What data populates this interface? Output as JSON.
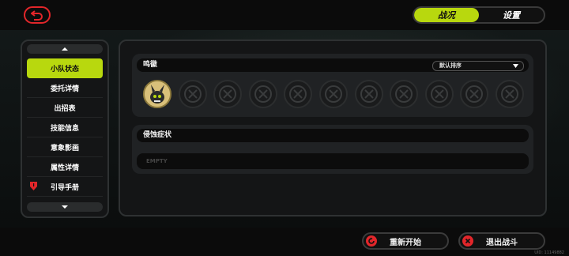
{
  "header": {
    "tabs": [
      {
        "label": "战况",
        "active": true
      },
      {
        "label": "设置",
        "active": false
      }
    ]
  },
  "sidebar": {
    "items": [
      {
        "label": "小队状态",
        "active": true
      },
      {
        "label": "委托详情",
        "active": false
      },
      {
        "label": "出招表",
        "active": false
      },
      {
        "label": "技能信息",
        "active": false
      },
      {
        "label": "意象影画",
        "active": false
      },
      {
        "label": "属性详情",
        "active": false
      },
      {
        "label": "引导手册",
        "active": false,
        "alert": true
      }
    ]
  },
  "main": {
    "badges_title": "鸣徽",
    "sort_select": "默认排序",
    "slots": [
      {
        "filled": true,
        "icon": "bangboo-badge-icon"
      },
      {
        "filled": false,
        "icon": "empty-slot-icon"
      },
      {
        "filled": false,
        "icon": "empty-slot-icon"
      },
      {
        "filled": false,
        "icon": "empty-slot-icon"
      },
      {
        "filled": false,
        "icon": "empty-slot-icon"
      },
      {
        "filled": false,
        "icon": "empty-slot-icon"
      },
      {
        "filled": false,
        "icon": "empty-slot-icon"
      },
      {
        "filled": false,
        "icon": "empty-slot-icon"
      },
      {
        "filled": false,
        "icon": "empty-slot-icon"
      },
      {
        "filled": false,
        "icon": "empty-slot-icon"
      },
      {
        "filled": false,
        "icon": "empty-slot-icon"
      }
    ],
    "erosion_title": "侵蚀症状",
    "erosion_empty": "EMPTY"
  },
  "footer": {
    "restart_label": "重新开始",
    "exit_label": "退出战斗",
    "uid": "UID: 11149882"
  },
  "colors": {
    "accent": "#b8d80e",
    "danger": "#e2262a"
  }
}
